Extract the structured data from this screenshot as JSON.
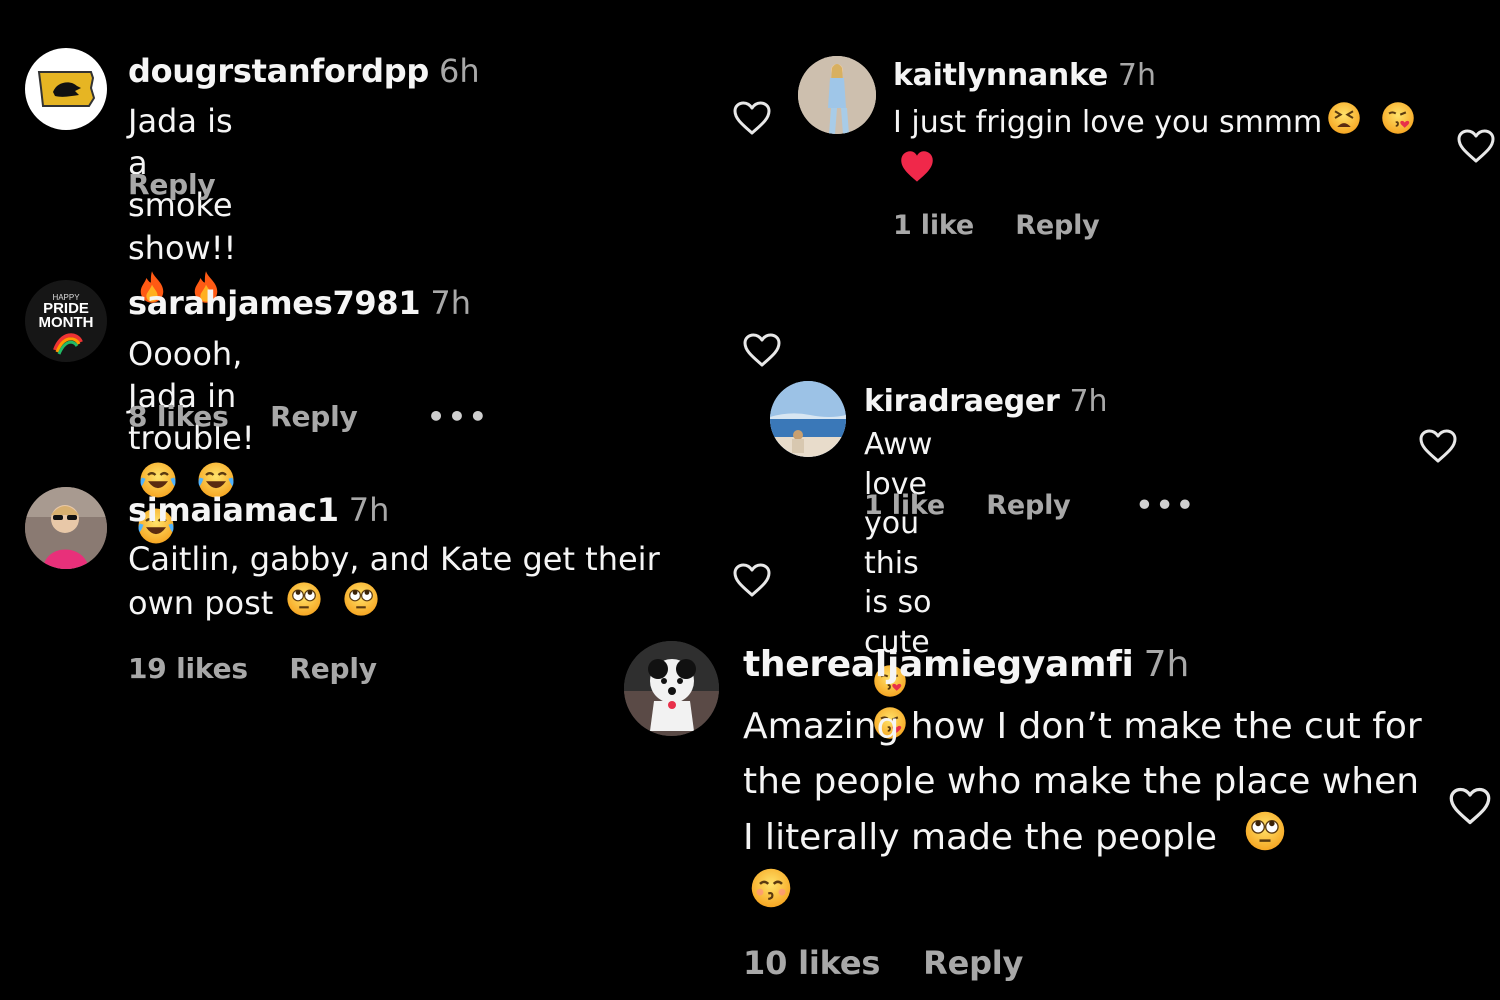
{
  "comments": [
    {
      "username": "dougrstanfordpp",
      "time": "6h",
      "text": "Jada is a smoke show!!",
      "emojis": [
        "fire-emoji",
        "fire-emoji"
      ],
      "likes": "",
      "reply_label": "Reply"
    },
    {
      "username": "sarahjames7981",
      "time": "7h",
      "text": "Ooooh, Jada in trouble!",
      "emojis": [
        "tears-of-joy-emoji",
        "tears-of-joy-emoji",
        "tears-of-joy-emoji"
      ],
      "likes": "8 likes",
      "reply_label": "Reply",
      "more": "•••",
      "avatar_text": {
        "small": "HAPPY",
        "line1": "PRIDE",
        "line2": "MONTH"
      }
    },
    {
      "username": "simaiamac1",
      "time": "7h",
      "text": "Caitlin, gabby, and Kate get their own post",
      "emojis": [
        "face-with-rolling-eyes-emoji",
        "face-with-rolling-eyes-emoji"
      ],
      "likes": "19 likes",
      "reply_label": "Reply"
    },
    {
      "username": "kaitlynnanke",
      "time": "7h",
      "text": "I just friggin love you smmm",
      "emojis": [
        "tired-face-emoji",
        "face-blowing-kiss-emoji",
        "red-heart-emoji"
      ],
      "likes": "1 like",
      "reply_label": "Reply"
    },
    {
      "username": "kiradraeger",
      "time": "7h",
      "text": "Aww love you this is so cute",
      "emojis": [
        "face-blowing-kiss-emoji",
        "face-blowing-kiss-emoji"
      ],
      "likes": "1 like",
      "reply_label": "Reply",
      "more": "•••"
    },
    {
      "username": "therealjamiegyamfi",
      "time": "7h",
      "text": "Amazing how I don’t make the cut for the people who make the place when I literally made the people",
      "emojis": [
        "face-with-rolling-eyes-emoji",
        "kissing-face-emoji"
      ],
      "likes": "10 likes",
      "reply_label": "Reply"
    }
  ],
  "colors": {
    "background": "#000000",
    "text": "#f5f5f5",
    "secondary": "#a8a8a8",
    "emoji_yellow": "#ffcc33",
    "heart_red": "#f0284a",
    "fire_orange": "#ff6a1a"
  }
}
